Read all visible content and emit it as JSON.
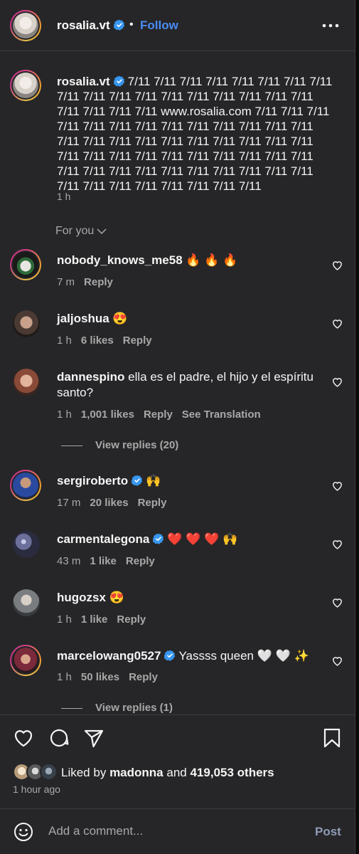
{
  "header": {
    "username": "rosalia.vt",
    "separator": "•",
    "follow_label": "Follow",
    "more_icon": "more-horizontal-icon"
  },
  "caption": {
    "username": "rosalia.vt",
    "text": "7/11 7/11 7/11 7/11 7/11 7/11 7/11 7/11 7/11 7/11 7/11 7/11 7/11 7/11 7/11 7/11 7/11 7/11 7/11 7/11 7/11 7/11 www.rosalia.com 7/11 7/11 7/11 7/11 7/11 7/11 7/11 7/11 7/11 7/11 7/11 7/11 7/11 7/11 7/11 7/11 7/11 7/11 7/11 7/11 7/11 7/11 7/11 7/11 7/11 7/11 7/11 7/11 7/11 7/11 7/11 7/11 7/11 7/11 7/11 7/11 7/11 7/11 7/11 7/11 7/11 7/11 7/11 7/11 7/11 7/11 7/11 7/11 7/11 7/11 7/11",
    "time": "1 h"
  },
  "sort_label": "For you",
  "comments": [
    {
      "username": "nobody_knows_me58",
      "verified": false,
      "text": "🔥 🔥 🔥",
      "time": "7 m",
      "likes": "",
      "reply": "Reply",
      "translate": ""
    },
    {
      "username": "jaljoshua",
      "verified": false,
      "text": "😍",
      "time": "1 h",
      "likes": "6 likes",
      "reply": "Reply",
      "translate": ""
    },
    {
      "username": "dannespino",
      "verified": false,
      "text": "ella es el padre, el hijo y el espíritu santo?",
      "time": "1 h",
      "likes": "1,001 likes",
      "reply": "Reply",
      "translate": "See Translation"
    },
    {
      "username": "sergiroberto",
      "verified": true,
      "text": "🙌",
      "time": "17 m",
      "likes": "20 likes",
      "reply": "Reply",
      "translate": ""
    },
    {
      "username": "carmentalegona",
      "verified": true,
      "text": "❤️ ❤️ ❤️ 🙌",
      "time": "43 m",
      "likes": "1 like",
      "reply": "Reply",
      "translate": ""
    },
    {
      "username": "hugozsx",
      "verified": false,
      "text": "😍",
      "time": "1 h",
      "likes": "1 like",
      "reply": "Reply",
      "translate": ""
    },
    {
      "username": "marcelowang0527",
      "verified": true,
      "text": "Yassss queen 🤍 🤍 ✨",
      "time": "1 h",
      "likes": "50 likes",
      "reply": "Reply",
      "translate": ""
    }
  ],
  "view_replies": [
    "View replies (20)",
    "View replies (1)"
  ],
  "footer": {
    "liked_by_prefix": "Liked by",
    "liked_by_user": "madonna",
    "liked_by_and": "and",
    "liked_by_others": "419,053 others",
    "ago": "1 hour ago",
    "comment_placeholder": "Add a comment...",
    "post_label": "Post"
  },
  "colors": {
    "background": "#262628",
    "accent": "#4a8cf5",
    "muted": "#a8a8a8",
    "verified": "#3897f0"
  }
}
